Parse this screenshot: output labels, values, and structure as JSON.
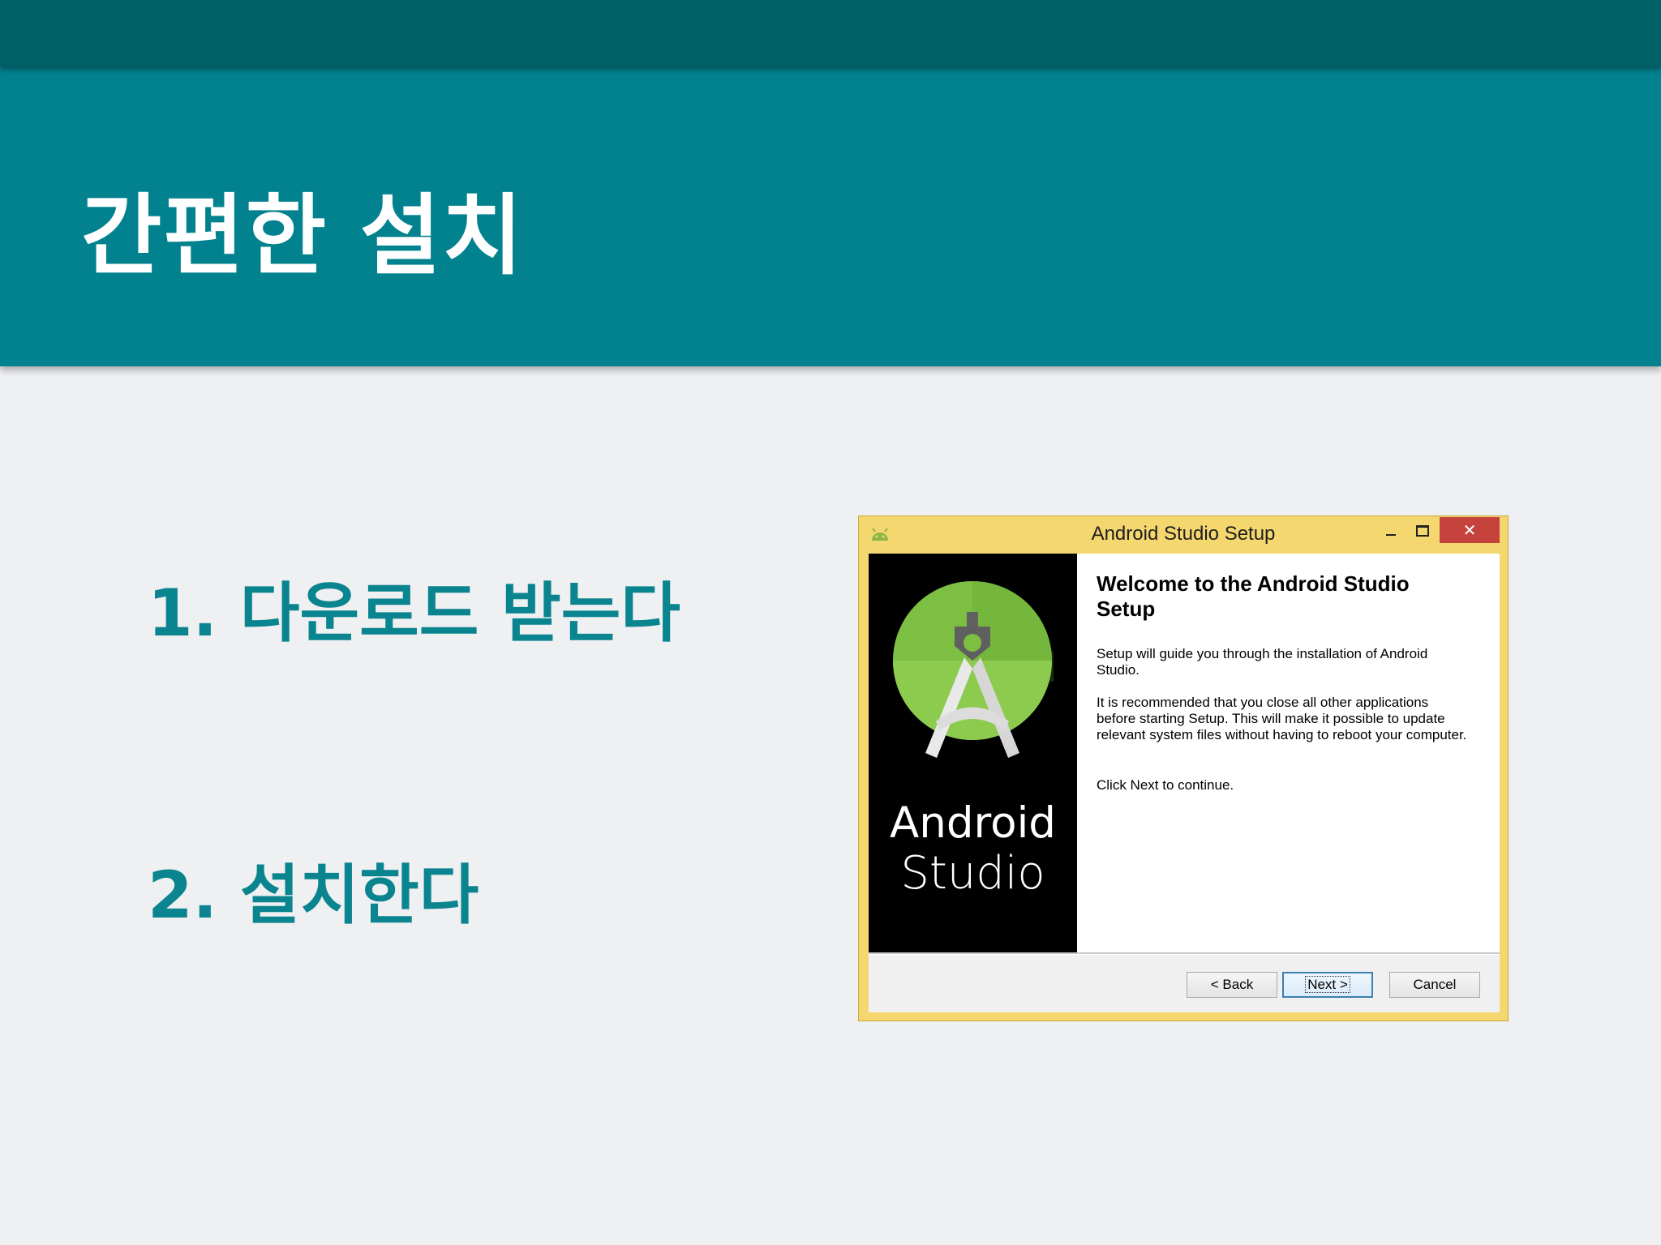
{
  "slide": {
    "title": "간편한 설치",
    "steps": [
      {
        "label": "1. 다운로드 받는다"
      },
      {
        "label": "2. 설치한다"
      }
    ]
  },
  "setup_window": {
    "title": "Android Studio Setup",
    "close_symbol": "✕",
    "brand": {
      "line1": "Android",
      "line2": "Studio"
    },
    "heading": "Welcome to the Android Studio Setup",
    "paragraphs": [
      "Setup will guide you through the installation of Android Studio.",
      "It is recommended that you close all other applications before starting Setup. This will make it possible to update relevant system files without having to reboot your computer.",
      "Click Next to continue."
    ],
    "buttons": {
      "back": "< Back",
      "next": "Next >",
      "cancel": "Cancel"
    }
  },
  "colors": {
    "top_bar": "#015f66",
    "header": "#02828f",
    "accent_text": "#0a848f",
    "window_frame": "#f4d76f",
    "close_button": "#c5433c",
    "logo_green": "#7cbf42"
  },
  "icons": [
    "android-icon",
    "minimize-icon",
    "maximize-icon",
    "close-icon",
    "android-studio-logo"
  ]
}
